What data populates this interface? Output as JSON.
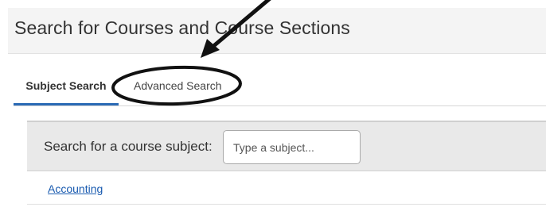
{
  "header": {
    "title": "Search for Courses and Course Sections"
  },
  "tabs": [
    {
      "label": "Subject Search",
      "active": true
    },
    {
      "label": "Advanced Search",
      "active": false
    }
  ],
  "search": {
    "label": "Search for a course subject:",
    "placeholder": "Type a subject...",
    "value": ""
  },
  "results": [
    {
      "label": "Accounting"
    }
  ],
  "annotation": {
    "arrow_icon": "arrow-icon",
    "highlight_icon": "ellipse-highlight-icon",
    "color": "#111111"
  },
  "colors": {
    "accent": "#2a6ab5",
    "link": "#1a5bb0",
    "panel": "#e9e9e9",
    "header": "#f4f4f4"
  }
}
